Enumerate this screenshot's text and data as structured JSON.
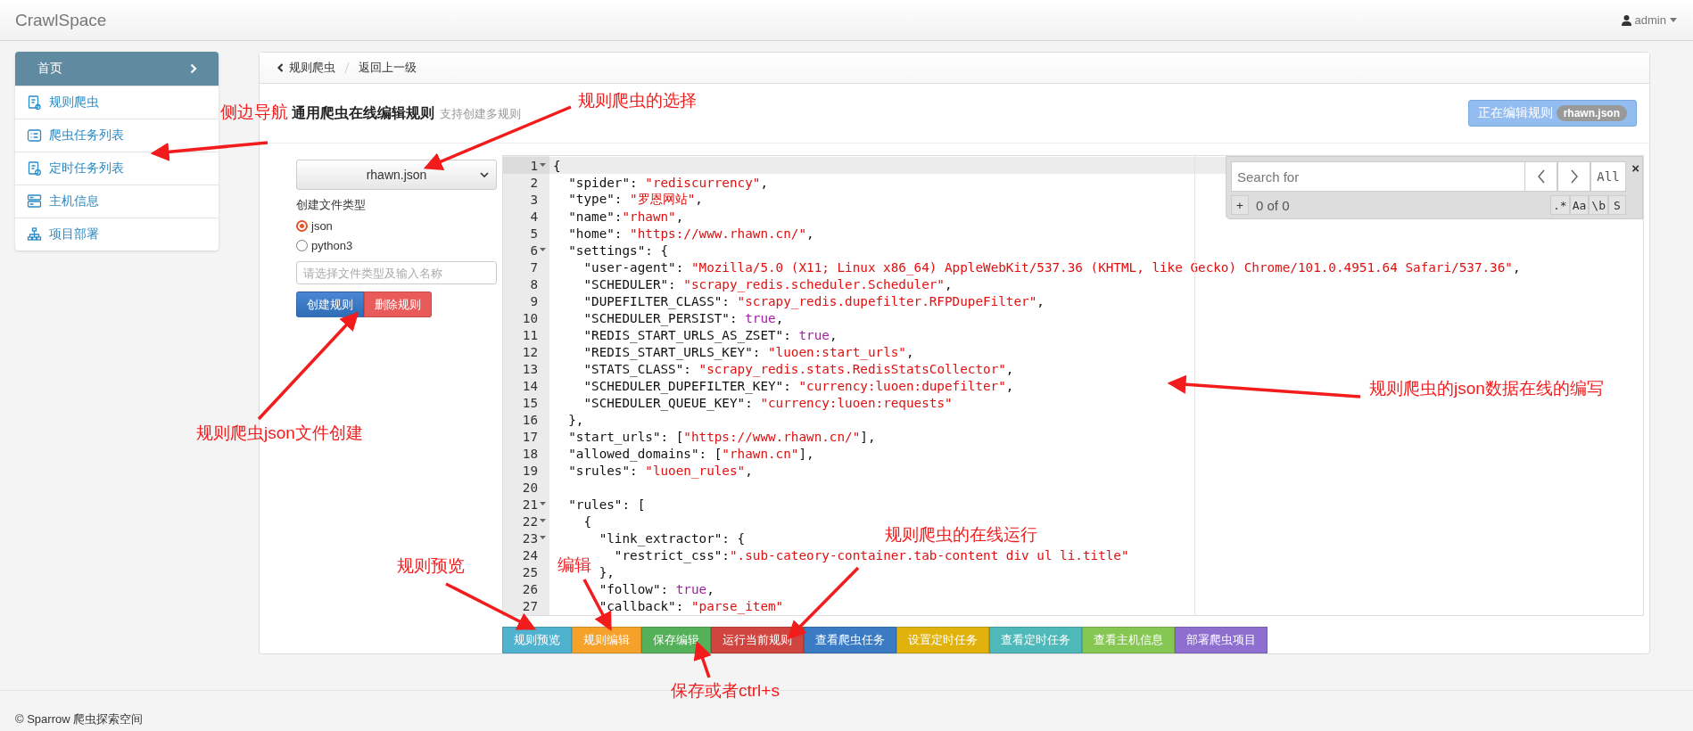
{
  "navbar": {
    "brand": "CrawlSpace",
    "user": "admin"
  },
  "sidebar": {
    "header": "首页",
    "items": [
      {
        "label": "规则爬虫"
      },
      {
        "label": "爬虫任务列表"
      },
      {
        "label": "定时任务列表"
      },
      {
        "label": "主机信息"
      },
      {
        "label": "项目部署"
      }
    ]
  },
  "breadcrumb": [
    "规则爬虫",
    "返回上一级"
  ],
  "heading": {
    "title": "通用爬虫在线编辑规则",
    "subtitle": "支持创建多规则",
    "editing_label": "正在编辑规则",
    "editing_file": "rhawn.json"
  },
  "form": {
    "file_select": "rhawn.json",
    "type_label": "创建文件类型",
    "types": [
      {
        "label": "json",
        "selected": true
      },
      {
        "label": "python3",
        "selected": false
      }
    ],
    "name_placeholder": "请选择文件类型及输入名称",
    "create": "创建规则",
    "delete": "删除规则"
  },
  "editor": {
    "search": {
      "placeholder": "Search for",
      "all": "All",
      "add": "+",
      "count": "0 of 0",
      "options": [
        ".*",
        "Aa",
        "\\b",
        "S"
      ],
      "close": "×"
    },
    "lines": [
      {
        "number": "1",
        "fold": true,
        "active": true,
        "tokens": [
          {
            "kind": "plain",
            "text": "{"
          }
        ]
      },
      {
        "number": "2",
        "fold": false,
        "active": false,
        "tokens": [
          {
            "kind": "plain",
            "text": "  \"spider\": "
          },
          {
            "kind": "string",
            "text": "\"rediscurrency\""
          },
          {
            "kind": "plain",
            "text": ","
          }
        ]
      },
      {
        "number": "3",
        "fold": false,
        "active": false,
        "tokens": [
          {
            "kind": "plain",
            "text": "  \"type\": "
          },
          {
            "kind": "string",
            "text": "\"罗恩网站\""
          },
          {
            "kind": "plain",
            "text": ","
          }
        ]
      },
      {
        "number": "4",
        "fold": false,
        "active": false,
        "tokens": [
          {
            "kind": "plain",
            "text": "  \"name\":"
          },
          {
            "kind": "string",
            "text": "\"rhawn\""
          },
          {
            "kind": "plain",
            "text": ","
          }
        ]
      },
      {
        "number": "5",
        "fold": false,
        "active": false,
        "tokens": [
          {
            "kind": "plain",
            "text": "  \"home\": "
          },
          {
            "kind": "string",
            "text": "\"https://www.rhawn.cn/\""
          },
          {
            "kind": "plain",
            "text": ","
          }
        ]
      },
      {
        "number": "6",
        "fold": true,
        "active": false,
        "tokens": [
          {
            "kind": "plain",
            "text": "  \"settings\": {"
          }
        ]
      },
      {
        "number": "7",
        "fold": false,
        "active": false,
        "tokens": [
          {
            "kind": "plain",
            "text": "    \"user-agent\": "
          },
          {
            "kind": "string",
            "text": "\"Mozilla/5.0 (X11; Linux x86_64) AppleWebKit/537.36 (KHTML, like Gecko) Chrome/101.0.4951.64 Safari/537.36\""
          },
          {
            "kind": "plain",
            "text": ","
          }
        ]
      },
      {
        "number": "8",
        "fold": false,
        "active": false,
        "tokens": [
          {
            "kind": "plain",
            "text": "    \"SCHEDULER\": "
          },
          {
            "kind": "string",
            "text": "\"scrapy_redis.scheduler.Scheduler\""
          },
          {
            "kind": "plain",
            "text": ","
          }
        ]
      },
      {
        "number": "9",
        "fold": false,
        "active": false,
        "tokens": [
          {
            "kind": "plain",
            "text": "    \"DUPEFILTER_CLASS\": "
          },
          {
            "kind": "string",
            "text": "\"scrapy_redis.dupefilter.RFPDupeFilter\""
          },
          {
            "kind": "plain",
            "text": ","
          }
        ]
      },
      {
        "number": "10",
        "fold": false,
        "active": false,
        "tokens": [
          {
            "kind": "plain",
            "text": "    \"SCHEDULER_PERSIST\": "
          },
          {
            "kind": "bool",
            "text": "true"
          },
          {
            "kind": "plain",
            "text": ","
          }
        ]
      },
      {
        "number": "11",
        "fold": false,
        "active": false,
        "tokens": [
          {
            "kind": "plain",
            "text": "    \"REDIS_START_URLS_AS_ZSET\": "
          },
          {
            "kind": "bool",
            "text": "true"
          },
          {
            "kind": "plain",
            "text": ","
          }
        ]
      },
      {
        "number": "12",
        "fold": false,
        "active": false,
        "tokens": [
          {
            "kind": "plain",
            "text": "    \"REDIS_START_URLS_KEY\": "
          },
          {
            "kind": "string",
            "text": "\"luoen:start_urls\""
          },
          {
            "kind": "plain",
            "text": ","
          }
        ]
      },
      {
        "number": "13",
        "fold": false,
        "active": false,
        "tokens": [
          {
            "kind": "plain",
            "text": "    \"STATS_CLASS\": "
          },
          {
            "kind": "string",
            "text": "\"scrapy_redis.stats.RedisStatsCollector\""
          },
          {
            "kind": "plain",
            "text": ","
          }
        ]
      },
      {
        "number": "14",
        "fold": false,
        "active": false,
        "tokens": [
          {
            "kind": "plain",
            "text": "    \"SCHEDULER_DUPEFILTER_KEY\": "
          },
          {
            "kind": "string",
            "text": "\"currency:luoen:dupefilter\""
          },
          {
            "kind": "plain",
            "text": ","
          }
        ]
      },
      {
        "number": "15",
        "fold": false,
        "active": false,
        "tokens": [
          {
            "kind": "plain",
            "text": "    \"SCHEDULER_QUEUE_KEY\": "
          },
          {
            "kind": "string",
            "text": "\"currency:luoen:requests\""
          }
        ]
      },
      {
        "number": "16",
        "fold": false,
        "active": false,
        "tokens": [
          {
            "kind": "plain",
            "text": "  },"
          }
        ]
      },
      {
        "number": "17",
        "fold": false,
        "active": false,
        "tokens": [
          {
            "kind": "plain",
            "text": "  \"start_urls\": ["
          },
          {
            "kind": "string",
            "text": "\"https://www.rhawn.cn/\""
          },
          {
            "kind": "plain",
            "text": "],"
          }
        ]
      },
      {
        "number": "18",
        "fold": false,
        "active": false,
        "tokens": [
          {
            "kind": "plain",
            "text": "  \"allowed_domains\": ["
          },
          {
            "kind": "string",
            "text": "\"rhawn.cn\""
          },
          {
            "kind": "plain",
            "text": "],"
          }
        ]
      },
      {
        "number": "19",
        "fold": false,
        "active": false,
        "tokens": [
          {
            "kind": "plain",
            "text": "  \"srules\": "
          },
          {
            "kind": "string",
            "text": "\"luoen_rules\""
          },
          {
            "kind": "plain",
            "text": ","
          }
        ]
      },
      {
        "number": "20",
        "fold": false,
        "active": false
      },
      {
        "number": "21",
        "fold": true,
        "active": false,
        "tokens": [
          {
            "kind": "plain",
            "text": "  \"rules\": ["
          }
        ]
      },
      {
        "number": "22",
        "fold": true,
        "active": false,
        "tokens": [
          {
            "kind": "plain",
            "text": "    {"
          }
        ]
      },
      {
        "number": "23",
        "fold": true,
        "active": false,
        "tokens": [
          {
            "kind": "plain",
            "text": "      \"link_extractor\": {"
          }
        ]
      },
      {
        "number": "24",
        "fold": false,
        "active": false,
        "tokens": [
          {
            "kind": "plain",
            "text": "        \"restrict_css\":"
          },
          {
            "kind": "string",
            "text": "\".sub-cateory-container.tab-content div ul li.title\""
          }
        ]
      },
      {
        "number": "25",
        "fold": false,
        "active": false,
        "tokens": [
          {
            "kind": "plain",
            "text": "      },"
          }
        ]
      },
      {
        "number": "26",
        "fold": false,
        "active": false,
        "tokens": [
          {
            "kind": "plain",
            "text": "      \"follow\": "
          },
          {
            "kind": "bool",
            "text": "true"
          },
          {
            "kind": "plain",
            "text": ","
          }
        ]
      },
      {
        "number": "27",
        "fold": false,
        "active": false,
        "tokens": [
          {
            "kind": "plain",
            "text": "      \"callback\": "
          },
          {
            "kind": "string",
            "text": "\"parse_item\""
          }
        ]
      }
    ]
  },
  "actions": [
    {
      "label": "规则预览",
      "color": "#4fb3cf"
    },
    {
      "label": "规则编辑",
      "color": "#f5a12a"
    },
    {
      "label": "保存编辑",
      "color": "#55b05a"
    },
    {
      "label": "运行当前规则",
      "color": "#d0453f"
    },
    {
      "label": "查看爬虫任务",
      "color": "#3a7bc4"
    },
    {
      "label": "设置定时任务",
      "color": "#e2b20c"
    },
    {
      "label": "查看定时任务",
      "color": "#4fb8b8"
    },
    {
      "label": "查看主机信息",
      "color": "#86c653"
    },
    {
      "label": "部署爬虫项目",
      "color": "#8e6fcf"
    }
  ],
  "footer": "© Sparrow 爬虫探索空间",
  "annotations": [
    "侧边导航",
    "规则爬虫的选择",
    "规则爬虫json文件创建",
    "规则爬虫的json数据在线的编写",
    "规则预览",
    "编辑",
    "规则爬虫的在线运行",
    "保存或者ctrl+s"
  ]
}
